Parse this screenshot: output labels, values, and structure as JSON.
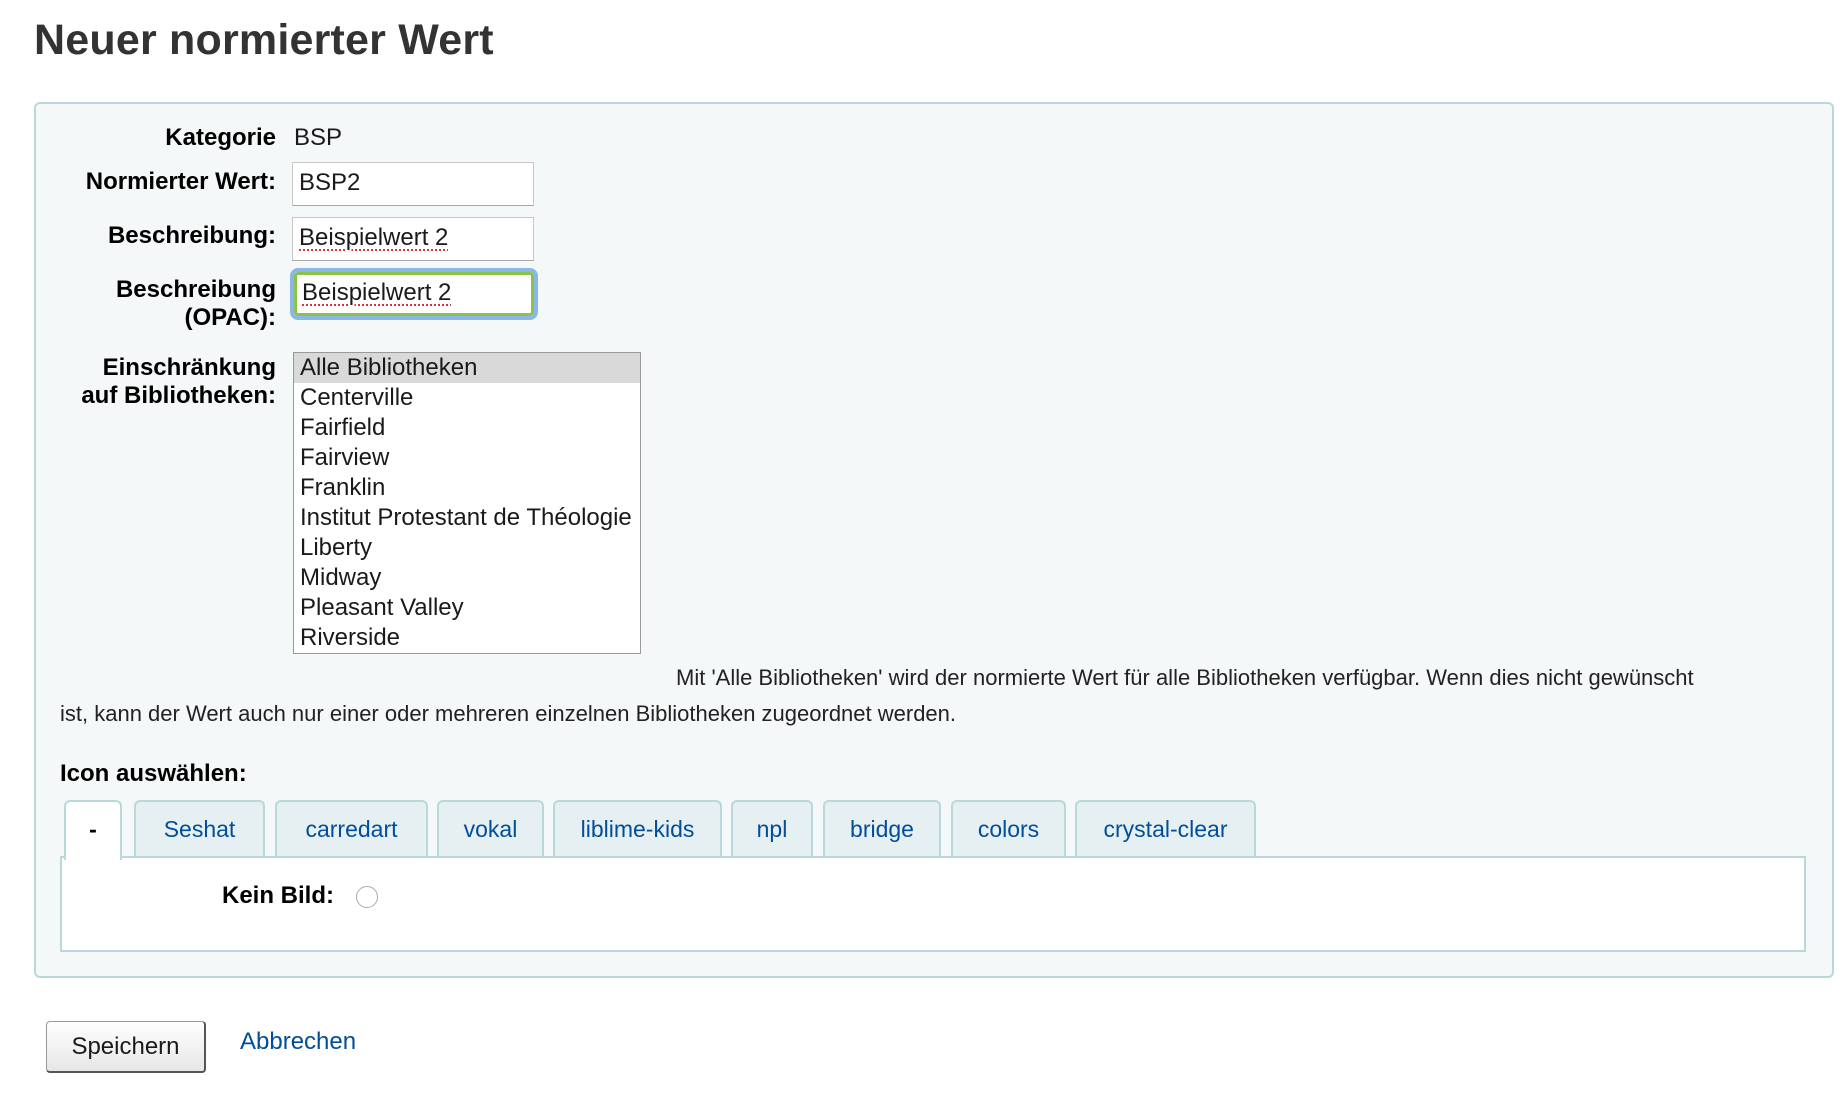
{
  "page": {
    "title": "Neuer normierter Wert"
  },
  "form": {
    "category_label": "Kategorie",
    "category_value": "BSP",
    "authorised_value_label": "Normierter Wert:",
    "authorised_value": "BSP2",
    "description_label": "Beschreibung:",
    "description_value": "Beispielwert 2",
    "description_opac_label_line1": "Beschreibung",
    "description_opac_label_line2": "(OPAC):",
    "description_opac_value": "Beispielwert 2",
    "libraries_label_line1": "Einschränkung",
    "libraries_label_line2": "auf Bibliotheken:",
    "libraries": [
      {
        "label": "Alle Bibliotheken",
        "selected": true
      },
      {
        "label": "Centerville",
        "selected": false
      },
      {
        "label": "Fairfield",
        "selected": false
      },
      {
        "label": "Fairview",
        "selected": false
      },
      {
        "label": "Franklin",
        "selected": false
      },
      {
        "label": "Institut Protestant de Théologie",
        "selected": false
      },
      {
        "label": "Liberty",
        "selected": false
      },
      {
        "label": "Midway",
        "selected": false
      },
      {
        "label": "Pleasant Valley",
        "selected": false
      },
      {
        "label": "Riverside",
        "selected": false
      }
    ],
    "libraries_hint_line1": "Mit 'Alle Bibliotheken' wird der normierte Wert für alle Bibliotheken verfügbar. Wenn dies nicht gewünscht",
    "libraries_hint_line2": "ist, kann der Wert auch nur einer oder mehreren einzelnen Bibliotheken zugeordnet werden.",
    "icon_label": "Icon auswählen:",
    "icon_tabs": [
      "-",
      "Seshat",
      "carredart",
      "vokal",
      "liblime-kids",
      "npl",
      "bridge",
      "colors",
      "crystal-clear"
    ],
    "active_tab": "-",
    "no_image_label": "Kein Bild:"
  },
  "actions": {
    "save_label": "Speichern",
    "cancel_label": "Abbrechen"
  },
  "colors": {
    "panel_bg": "#f4f8f9",
    "panel_border": "#b9d8d9",
    "link": "#004d99",
    "focus_outline": "#8ab7e8",
    "focus_border": "#8bc34a"
  }
}
